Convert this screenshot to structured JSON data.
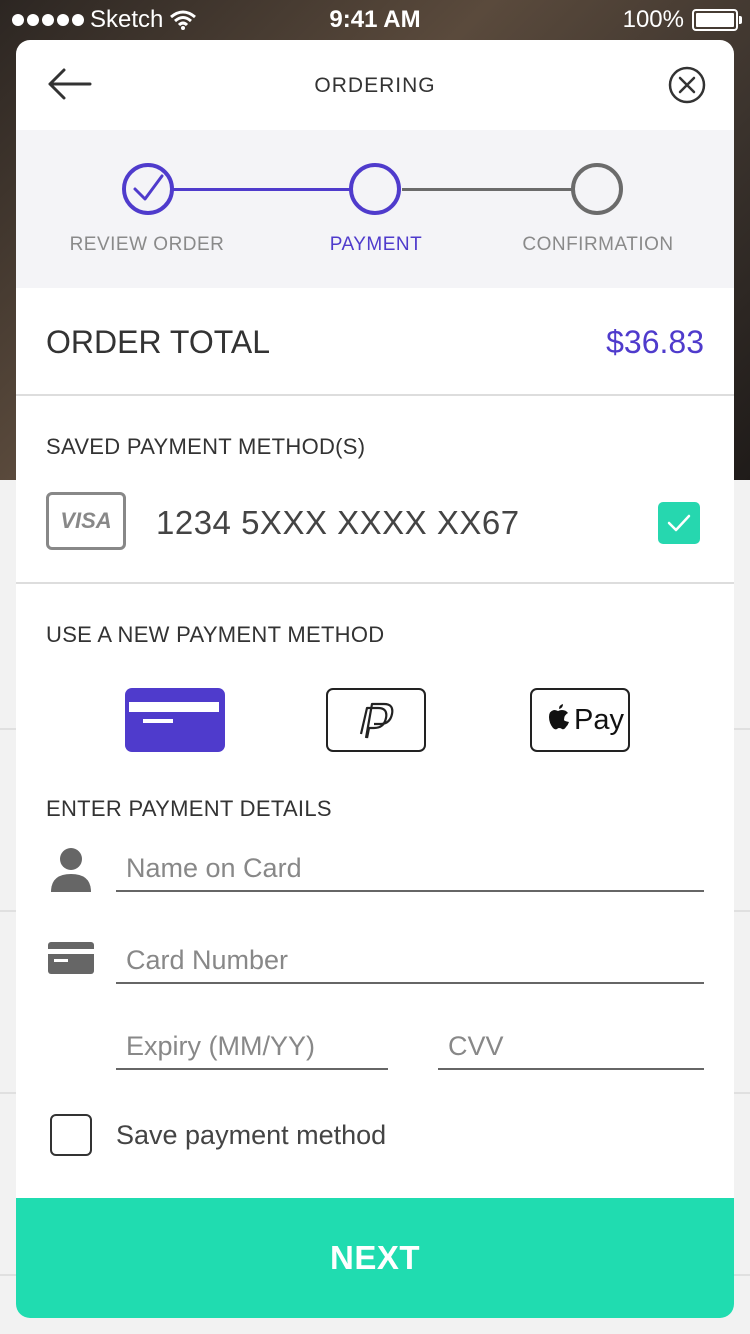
{
  "status_bar": {
    "carrier": "Sketch",
    "time": "9:41 AM",
    "battery": "100%"
  },
  "header": {
    "title": "ORDERING",
    "back_icon": "arrow-left-icon",
    "close_icon": "close-circle-icon"
  },
  "stepper": {
    "steps": [
      {
        "label": "REVIEW ORDER",
        "state": "completed"
      },
      {
        "label": "PAYMENT",
        "state": "active"
      },
      {
        "label": "CONFIRMATION",
        "state": "pending"
      }
    ]
  },
  "order_total": {
    "label": "ORDER TOTAL",
    "value": "$36.83"
  },
  "saved_payment": {
    "heading": "SAVED PAYMENT METHOD(S)",
    "card_brand": "VISA",
    "card_number": "1234 5XXX XXXX XX67",
    "selected": true
  },
  "new_payment": {
    "heading": "USE A NEW PAYMENT METHOD",
    "methods": [
      {
        "name": "credit-card-icon",
        "selected": true
      },
      {
        "name": "paypal-icon",
        "selected": false
      },
      {
        "name": "apple-pay-icon",
        "label": "Pay",
        "selected": false
      }
    ]
  },
  "payment_details": {
    "heading": "ENTER PAYMENT DETAILS",
    "name_placeholder": "Name on Card",
    "card_number_placeholder": "Card Number",
    "expiry_placeholder": "Expiry (MM/YY)",
    "cvv_placeholder": "CVV",
    "save_label": "Save payment method"
  },
  "footer": {
    "next_label": "NEXT"
  },
  "colors": {
    "accent": "#4f3bcc",
    "success": "#26d7af",
    "next_button": "#20dcb0",
    "pending": "#6b6b6b"
  }
}
